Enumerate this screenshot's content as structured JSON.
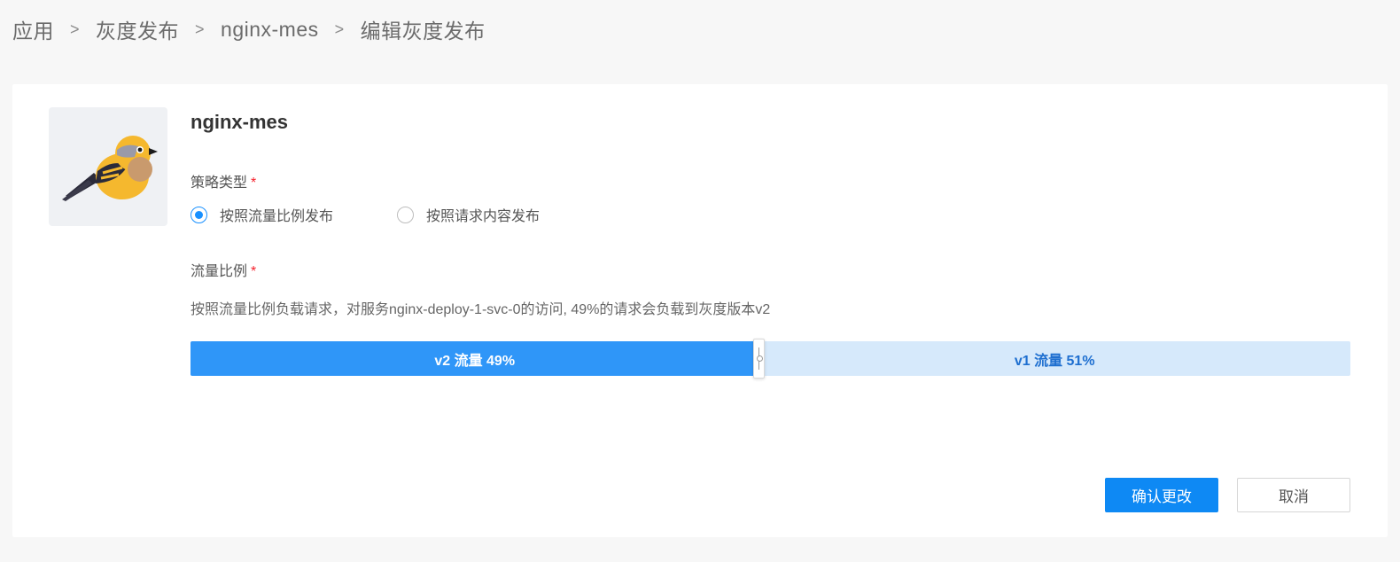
{
  "breadcrumb": {
    "items": [
      "应用",
      "灰度发布",
      "nginx-mes",
      "编辑灰度发布"
    ],
    "separator": ">"
  },
  "app": {
    "name": "nginx-mes",
    "avatar_icon": "bird-icon"
  },
  "strategy": {
    "label": "策略类型",
    "required_mark": "*",
    "options": [
      {
        "label": "按照流量比例发布",
        "checked": true
      },
      {
        "label": "按照请求内容发布",
        "checked": false
      }
    ]
  },
  "ratio": {
    "label": "流量比例",
    "required_mark": "*",
    "description": "按照流量比例负载请求，对服务nginx-deploy-1-svc-0的访问, 49%的请求会负载到灰度版本v2",
    "v2_label": "v2 流量 49%",
    "v1_label": "v1 流量 51%",
    "v2_percent": 49,
    "v1_percent": 51
  },
  "buttons": {
    "confirm": "确认更改",
    "cancel": "取消"
  },
  "colors": {
    "primary": "#0e89f4",
    "slider_fill": "#2f96f8",
    "slider_track": "#d6e9fb",
    "required": "#f5222d"
  }
}
